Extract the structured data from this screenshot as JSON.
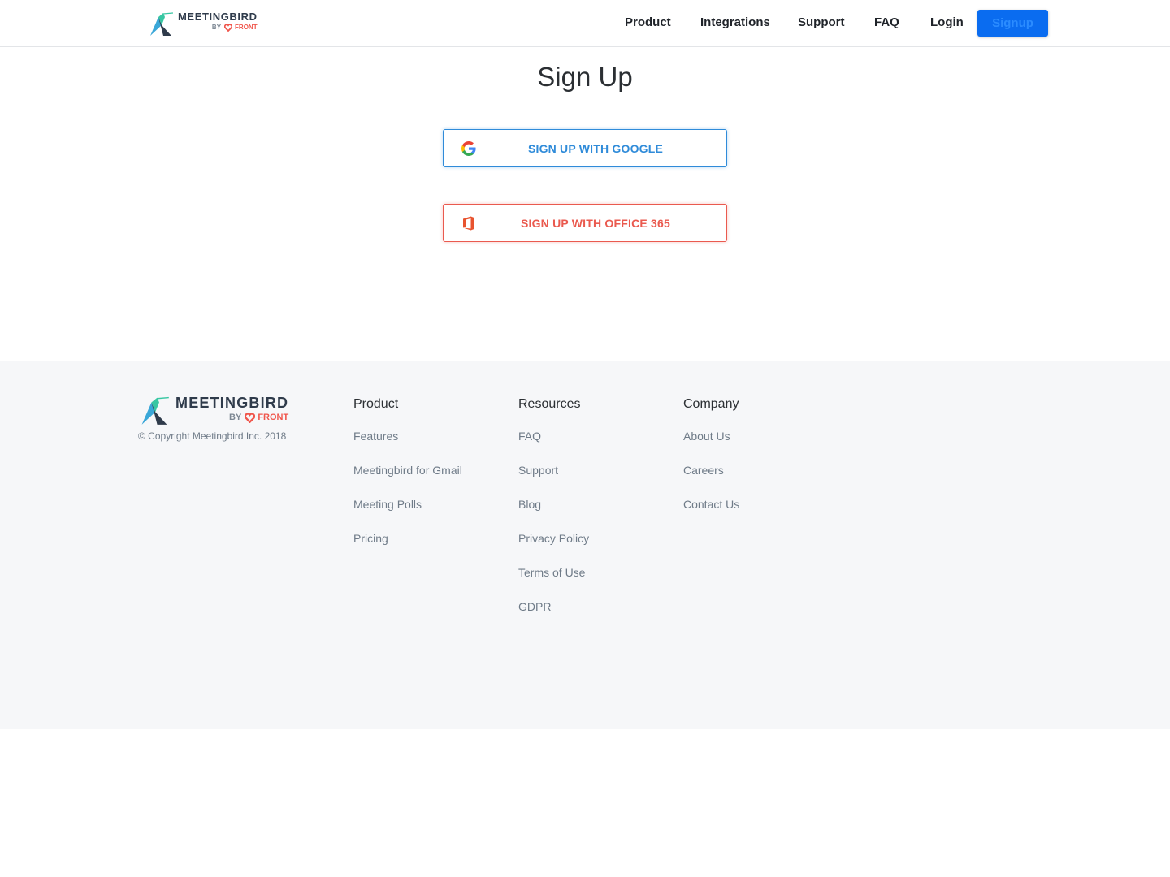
{
  "header": {
    "logo": {
      "brand": "MEETINGBIRD",
      "by": "BY",
      "front": "FRONT"
    },
    "nav": [
      "Product",
      "Integrations",
      "Support",
      "FAQ",
      "Login"
    ],
    "signup_label": "Signup"
  },
  "main": {
    "title": "Sign Up",
    "google_label": "SIGN UP WITH GOOGLE",
    "office_label": "SIGN UP WITH OFFICE 365"
  },
  "footer": {
    "logo": {
      "brand": "MEETINGBIRD",
      "by": "BY",
      "front": "FRONT"
    },
    "copyright": "© Copyright Meetingbird Inc. 2018",
    "columns": [
      {
        "heading": "Product",
        "links": [
          "Features",
          "Meetingbird for Gmail",
          "Meeting Polls",
          "Pricing"
        ]
      },
      {
        "heading": "Resources",
        "links": [
          "FAQ",
          "Support",
          "Blog",
          "Privacy Policy",
          "Terms of Use",
          "GDPR"
        ]
      },
      {
        "heading": "Company",
        "links": [
          "About Us",
          "Careers",
          "Contact Us"
        ]
      }
    ]
  },
  "colors": {
    "accent_blue": "#0a6cf0",
    "google_blue": "#2f8bd9",
    "office_red": "#ea5a4f",
    "front_red": "#f0564c",
    "footer_bg": "#f6f7f9"
  }
}
